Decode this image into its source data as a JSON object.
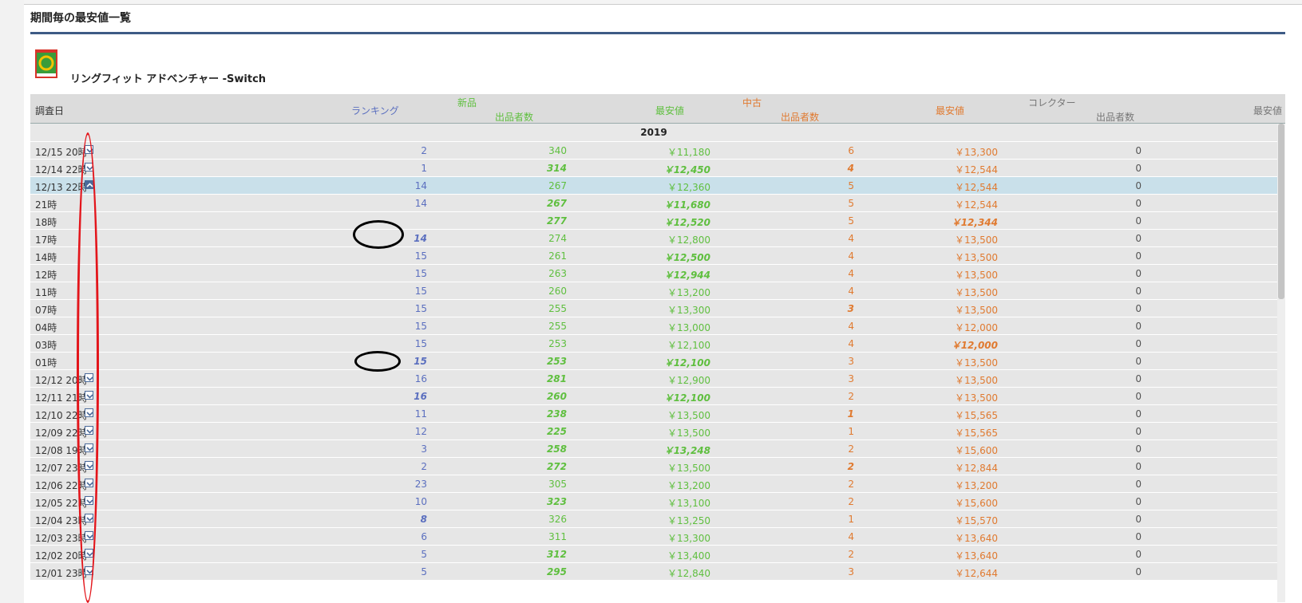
{
  "section_title": "期間毎の最安値一覧",
  "product": {
    "name": "リングフィット アドベンチャー -Switch",
    "image_icon": "game-box-icon"
  },
  "headers": {
    "date": "調査日",
    "ranking": "ランキング",
    "new": "新品",
    "new_sellers": "出品者数",
    "new_lowest": "最安値",
    "used": "中古",
    "used_sellers": "出品者数",
    "used_lowest": "最安値",
    "collector": "コレクター",
    "collector_sellers": "出品者数",
    "collector_lowest": "最安値"
  },
  "year": "2019",
  "colors": {
    "ranking": "#5b6fbf",
    "new": "#5fbf3f",
    "used": "#e07a30",
    "accent_rule": "#3e5b85",
    "highlight_row": "#c9e0ea",
    "annotation_red": "#e3151b",
    "annotation_black": "#000000"
  },
  "rows": [
    {
      "date": "12/15 20時",
      "rank": "2",
      "new_sellers": "340",
      "new_price": "￥11,180",
      "used_sellers": "6",
      "used_price": "￥13,300",
      "col_sellers": "0"
    },
    {
      "date": "12/14 22時",
      "rank": "1",
      "new_sellers": "314",
      "new_price": "￥12,450",
      "used_sellers": "4",
      "used_price": "￥12,544",
      "col_sellers": "0"
    },
    {
      "date": "12/13 22時",
      "rank": "14",
      "new_sellers": "267",
      "new_price": "￥12,360",
      "used_sellers": "5",
      "used_price": "￥12,544",
      "col_sellers": "0"
    },
    {
      "date": "21時",
      "rank": "14",
      "new_sellers": "267",
      "new_price": "￥11,680",
      "used_sellers": "5",
      "used_price": "￥12,544",
      "col_sellers": "0"
    },
    {
      "date": "18時",
      "rank": "",
      "new_sellers": "277",
      "new_price": "￥12,520",
      "used_sellers": "5",
      "used_price": "￥12,344",
      "col_sellers": "0"
    },
    {
      "date": "17時",
      "rank": "14",
      "new_sellers": "274",
      "new_price": "￥12,800",
      "used_sellers": "4",
      "used_price": "￥13,500",
      "col_sellers": "0"
    },
    {
      "date": "14時",
      "rank": "15",
      "new_sellers": "261",
      "new_price": "￥12,500",
      "used_sellers": "4",
      "used_price": "￥13,500",
      "col_sellers": "0"
    },
    {
      "date": "12時",
      "rank": "15",
      "new_sellers": "263",
      "new_price": "￥12,944",
      "used_sellers": "4",
      "used_price": "￥13,500",
      "col_sellers": "0"
    },
    {
      "date": "11時",
      "rank": "15",
      "new_sellers": "260",
      "new_price": "￥13,200",
      "used_sellers": "4",
      "used_price": "￥13,500",
      "col_sellers": "0"
    },
    {
      "date": "07時",
      "rank": "15",
      "new_sellers": "255",
      "new_price": "￥13,300",
      "used_sellers": "3",
      "used_price": "￥13,500",
      "col_sellers": "0"
    },
    {
      "date": "04時",
      "rank": "15",
      "new_sellers": "255",
      "new_price": "￥13,000",
      "used_sellers": "4",
      "used_price": "￥12,000",
      "col_sellers": "0"
    },
    {
      "date": "03時",
      "rank": "15",
      "new_sellers": "253",
      "new_price": "￥12,100",
      "used_sellers": "4",
      "used_price": "￥12,000",
      "col_sellers": "0"
    },
    {
      "date": "01時",
      "rank": "15",
      "new_sellers": "253",
      "new_price": "￥12,100",
      "used_sellers": "3",
      "used_price": "￥13,500",
      "col_sellers": "0"
    },
    {
      "date": "12/12 20時",
      "rank": "16",
      "new_sellers": "281",
      "new_price": "￥12,900",
      "used_sellers": "3",
      "used_price": "￥13,500",
      "col_sellers": "0"
    },
    {
      "date": "12/11 21時",
      "rank": "16",
      "new_sellers": "260",
      "new_price": "￥12,100",
      "used_sellers": "2",
      "used_price": "￥13,500",
      "col_sellers": "0"
    },
    {
      "date": "12/10 22時",
      "rank": "11",
      "new_sellers": "238",
      "new_price": "￥13,500",
      "used_sellers": "1",
      "used_price": "￥15,565",
      "col_sellers": "0"
    },
    {
      "date": "12/09 22時",
      "rank": "12",
      "new_sellers": "225",
      "new_price": "￥13,500",
      "used_sellers": "1",
      "used_price": "￥15,565",
      "col_sellers": "0"
    },
    {
      "date": "12/08 19時",
      "rank": "3",
      "new_sellers": "258",
      "new_price": "￥13,248",
      "used_sellers": "2",
      "used_price": "￥15,600",
      "col_sellers": "0"
    },
    {
      "date": "12/07 23時",
      "rank": "2",
      "new_sellers": "272",
      "new_price": "￥13,500",
      "used_sellers": "2",
      "used_price": "￥12,844",
      "col_sellers": "0"
    },
    {
      "date": "12/06 22時",
      "rank": "23",
      "new_sellers": "305",
      "new_price": "￥13,200",
      "used_sellers": "2",
      "used_price": "￥13,200",
      "col_sellers": "0"
    },
    {
      "date": "12/05 22時",
      "rank": "10",
      "new_sellers": "323",
      "new_price": "￥13,100",
      "used_sellers": "2",
      "used_price": "￥15,600",
      "col_sellers": "0"
    },
    {
      "date": "12/04 23時",
      "rank": "8",
      "new_sellers": "326",
      "new_price": "￥13,250",
      "used_sellers": "1",
      "used_price": "￥15,570",
      "col_sellers": "0"
    },
    {
      "date": "12/03 23時",
      "rank": "6",
      "new_sellers": "311",
      "new_price": "￥13,300",
      "used_sellers": "4",
      "used_price": "￥13,640",
      "col_sellers": "0"
    },
    {
      "date": "12/02 20時",
      "rank": "5",
      "new_sellers": "312",
      "new_price": "￥13,400",
      "used_sellers": "2",
      "used_price": "￥13,640",
      "col_sellers": "0"
    },
    {
      "date": "12/01 23時",
      "rank": "5",
      "new_sellers": "295",
      "new_price": "￥12,840",
      "used_sellers": "3",
      "used_price": "￥12,644",
      "col_sellers": "0"
    }
  ]
}
